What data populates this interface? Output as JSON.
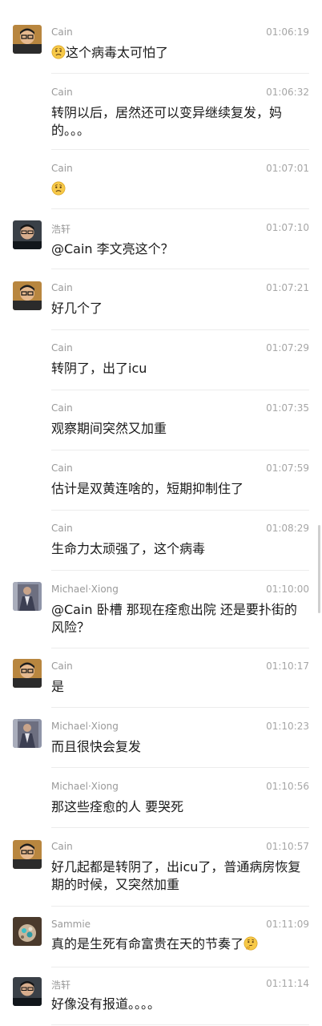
{
  "messages": [
    {
      "sender": "Cain",
      "time": "01:06:19",
      "text": "这个病毒太可怕了",
      "lead_emoji": "worried-face-icon",
      "avatar": "cain"
    },
    {
      "sender": "Cain",
      "time": "01:06:32",
      "text": "转阴以后，居然还可以变异继续复发，妈的。。。"
    },
    {
      "sender": "Cain",
      "time": "01:07:01",
      "text": "",
      "lead_emoji": "worried-face-icon"
    },
    {
      "sender": "浩轩",
      "time": "01:07:10",
      "text": "@Cain 李文亮这个？",
      "avatar": "haoxuan"
    },
    {
      "sender": "Cain",
      "time": "01:07:21",
      "text": "好几个了",
      "avatar": "cain"
    },
    {
      "sender": "Cain",
      "time": "01:07:29",
      "text": "转阴了，出了icu"
    },
    {
      "sender": "Cain",
      "time": "01:07:35",
      "text": "观察期间突然又加重"
    },
    {
      "sender": "Cain",
      "time": "01:07:59",
      "text": "估计是双黄连啥的，短期抑制住了"
    },
    {
      "sender": "Cain",
      "time": "01:08:29",
      "text": "生命力太顽强了，这个病毒"
    },
    {
      "sender": "Michael·Xiong",
      "time": "01:10:00",
      "text": "@Cain 卧槽 那现在痊愈出院  还是要扑街的风险？",
      "avatar": "michael"
    },
    {
      "sender": "Cain",
      "time": "01:10:17",
      "text": "是",
      "avatar": "cain"
    },
    {
      "sender": "Michael·Xiong",
      "time": "01:10:23",
      "text": "而且很快会复发",
      "avatar": "michael"
    },
    {
      "sender": "Michael·Xiong",
      "time": "01:10:56",
      "text": "那这些痊愈的人 要哭死"
    },
    {
      "sender": "Cain",
      "time": "01:10:57",
      "text": "好几起都是转阴了，出icu了，普通病房恢复期的时候，又突然加重",
      "avatar": "cain"
    },
    {
      "sender": "Sammie",
      "time": "01:11:09",
      "text": "真的是生死有命富贵在天的节奏了",
      "trail_emoji": "thinking-face-icon",
      "avatar": "sammie"
    },
    {
      "sender": "浩轩",
      "time": "01:11:14",
      "text": "好像没有报道。。。。",
      "avatar": "haoxuan"
    }
  ]
}
